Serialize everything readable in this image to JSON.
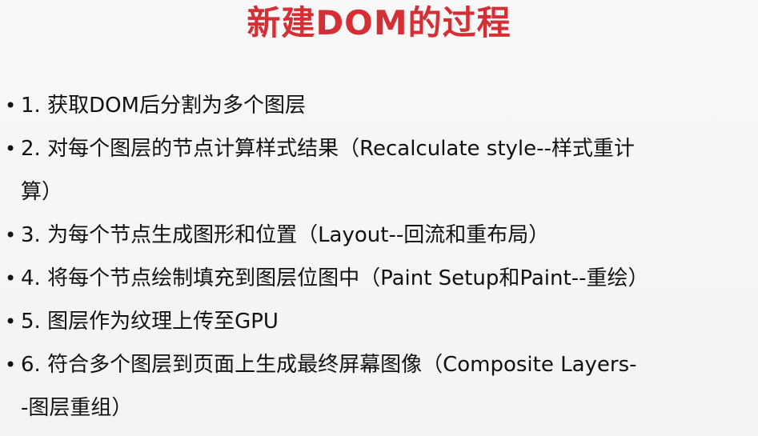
{
  "slide": {
    "title": "新建DOM的过程",
    "items": [
      {
        "line1": "1. 获取DOM后分割为多个图层"
      },
      {
        "line1": "2. 对每个图层的节点计算样式结果（Recalculate style--样式重计",
        "line2": "算）"
      },
      {
        "line1": "3. 为每个节点生成图形和位置（Layout--回流和重布局）"
      },
      {
        "line1": "4. 将每个节点绘制填充到图层位图中（Paint Setup和Paint--重绘）"
      },
      {
        "line1": "5. 图层作为纹理上传至GPU"
      },
      {
        "line1": "6. 符合多个图层到页面上生成最终屏幕图像（Composite Layers-",
        "line2": "-图层重组）"
      }
    ],
    "bullet": "•"
  }
}
